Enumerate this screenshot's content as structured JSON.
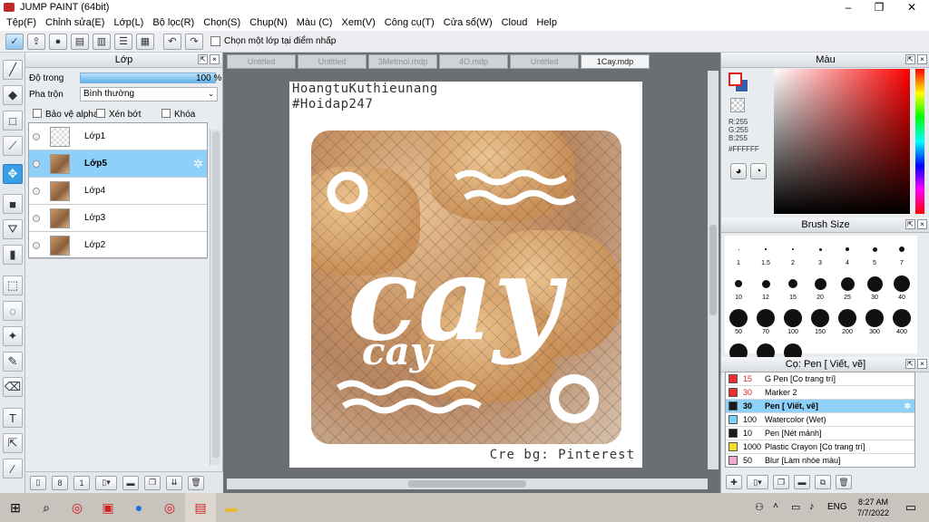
{
  "window": {
    "title": "JUMP PAINT (64bit)",
    "minimize": "–",
    "maximize": "❐",
    "close": "✕"
  },
  "menu": [
    "Tệp(F)",
    "Chỉnh sửa(E)",
    "Lớp(L)",
    "Bộ lọc(R)",
    "Chọn(S)",
    "Chụp(N)",
    "Màu (C)",
    "Xem(V)",
    "Công cụ(T)",
    "Cửa sổ(W)",
    "Cloud",
    "Help"
  ],
  "toolbar": {
    "select_layer_label": "Chọn một lớp tại điểm nhấp"
  },
  "layer_panel": {
    "title": "Lớp",
    "opacity_label": "Độ trong",
    "opacity_value": "100 %",
    "opacity_level": 1.0,
    "blend_label": "Pha trộn",
    "blend_value": "Bình thường",
    "protect_alpha": "Bảo vệ alpha",
    "clipping": "Xén bớt",
    "lock": "Khóa",
    "layers": [
      {
        "name": "Lớp1"
      },
      {
        "name": "Lớp5"
      },
      {
        "name": "Lớp4"
      },
      {
        "name": "Lớp3"
      },
      {
        "name": "Lớp2"
      }
    ]
  },
  "tabs": [
    "Untitled",
    "Untitled",
    "3Metmoi.mdp",
    "4O.mdp",
    "Untitled",
    "1Cay.mdp"
  ],
  "canvas": {
    "line1": "HoangtuKuthieunang",
    "line2": "#Hoidap247",
    "art_word_big": "cay",
    "art_word_small": "cay",
    "credit": "Cre bg: Pinterest"
  },
  "color_panel": {
    "title": "Màu",
    "r": "R:255",
    "g": "G:255",
    "b": "B:255",
    "hex": "#FFFFFF",
    "fg_color": "#ffffff",
    "bg_color": "#355fa8"
  },
  "brush_panel": {
    "title": "Brush Size",
    "sizes": [
      "1",
      "1.5",
      "2",
      "3",
      "4",
      "5",
      "7",
      "10",
      "12",
      "15",
      "20",
      "25",
      "30",
      "40",
      "50",
      "70",
      "100",
      "150",
      "200",
      "300",
      "400",
      "",
      "",
      ""
    ]
  },
  "subtool_panel": {
    "title": "Cọ: Pen [ Viết, vẽ]",
    "items": [
      {
        "size": "15",
        "name": "G Pen [Cọ trang trí]",
        "color": "#e83030"
      },
      {
        "size": "30",
        "name": "Marker 2",
        "color": "#e83030"
      },
      {
        "size": "30",
        "name": "Pen [ Viết, vẽ]",
        "color": "#1a1a1a"
      },
      {
        "size": "100",
        "name": "Watercolor (Wet)",
        "color": "#7ad3f5"
      },
      {
        "size": "10",
        "name": "Pen [Nét mảnh]",
        "color": "#1a1a1a"
      },
      {
        "size": "1000",
        "name": "Plastic Crayon [Cọ trang trí]",
        "color": "#f2df2a"
      },
      {
        "size": "50",
        "name": "Blur [Làm nhòe màu]",
        "color": "#f3a9c9"
      }
    ]
  },
  "taskbar": {
    "lang": "ENG",
    "time": "8:27 AM",
    "date": "7/7/2022"
  }
}
